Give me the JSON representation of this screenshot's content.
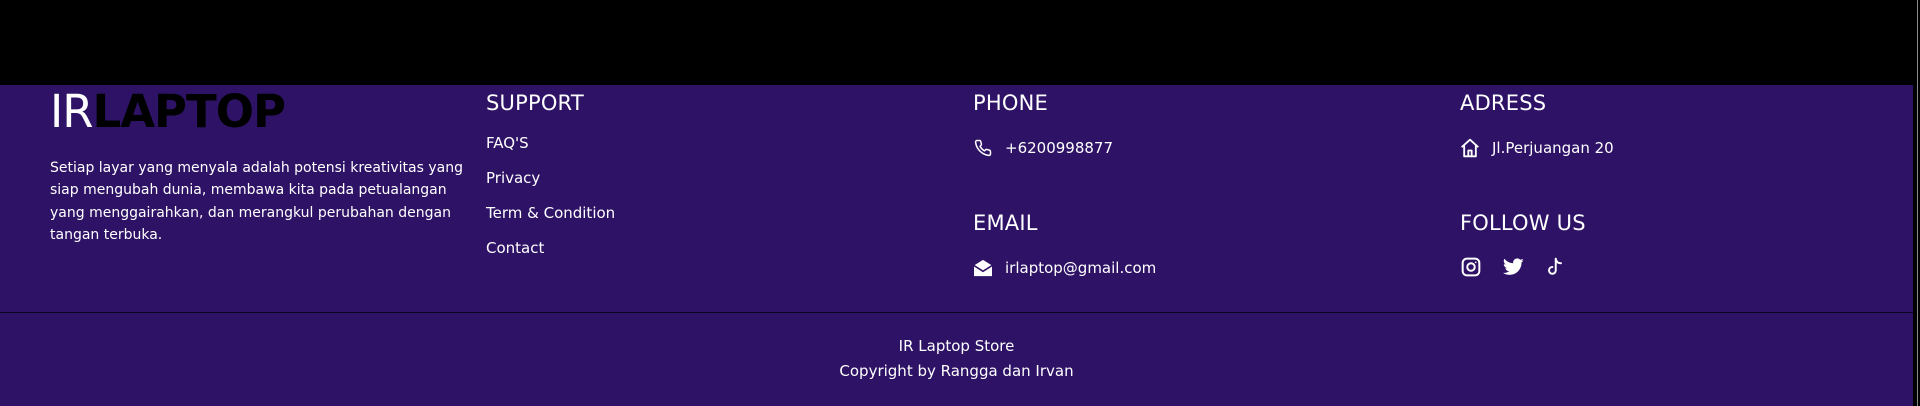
{
  "brand": {
    "logo_part1": "IR",
    "logo_part2": "LAPTOP",
    "description": "Setiap layar yang menyala adalah potensi kreativitas yang siap mengubah dunia, membawa kita pada petualangan yang menggairahkan, dan merangkul perubahan dengan tangan terbuka."
  },
  "support": {
    "title": "SUPPORT",
    "links": [
      {
        "label": "FAQ'S"
      },
      {
        "label": "Privacy"
      },
      {
        "label": "Term & Condition"
      },
      {
        "label": "Contact"
      }
    ]
  },
  "phone": {
    "title": "PHONE",
    "icon": "phone-icon",
    "value": "+6200998877"
  },
  "email": {
    "title": "EMAIL",
    "icon": "envelope-icon",
    "value": "irlaptop@gmail.com"
  },
  "address": {
    "title": "ADRESS",
    "icon": "home-icon",
    "value": "Jl.Perjuangan 20"
  },
  "follow": {
    "title": "FOLLOW US",
    "icons": [
      "instagram-icon",
      "twitter-icon",
      "tiktok-icon"
    ]
  },
  "bottom": {
    "store": "IR Laptop Store",
    "copyright": "Copyright by Rangga dan Irvan"
  },
  "colors": {
    "footer_bg": "#2d1265",
    "top_bg": "#000000",
    "text": "#ffffff"
  }
}
